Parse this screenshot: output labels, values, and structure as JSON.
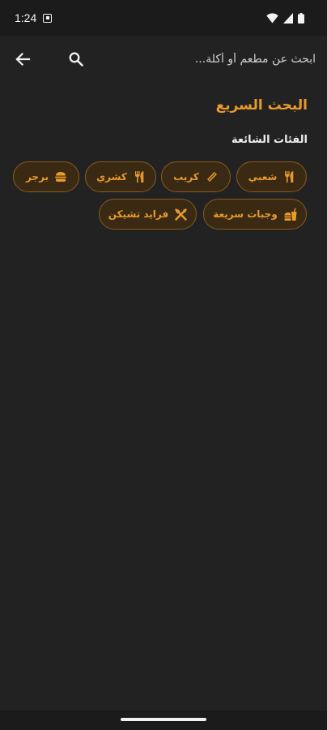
{
  "status_bar": {
    "time": "1:24"
  },
  "search": {
    "placeholder": "ابحث عن مطعم أو أكلة..."
  },
  "quick_search": {
    "title": "البحث السريع",
    "popular_label": "الفئات الشائعة"
  },
  "categories": [
    {
      "label": "شعبي",
      "icon": "fork-knife-icon"
    },
    {
      "label": "كريب",
      "icon": "crepe-icon"
    },
    {
      "label": "كشري",
      "icon": "fork-knife-icon"
    },
    {
      "label": "برجر",
      "icon": "burger-icon"
    },
    {
      "label": "وجبات سريعة",
      "icon": "fastfood-icon"
    },
    {
      "label": "فرايد تشيكن",
      "icon": "crossed-utensils-icon"
    }
  ],
  "colors": {
    "accent": "#e89a2c",
    "chip_border": "#8a5a1c",
    "chip_bg": "#3a2a14",
    "background": "#222222"
  }
}
